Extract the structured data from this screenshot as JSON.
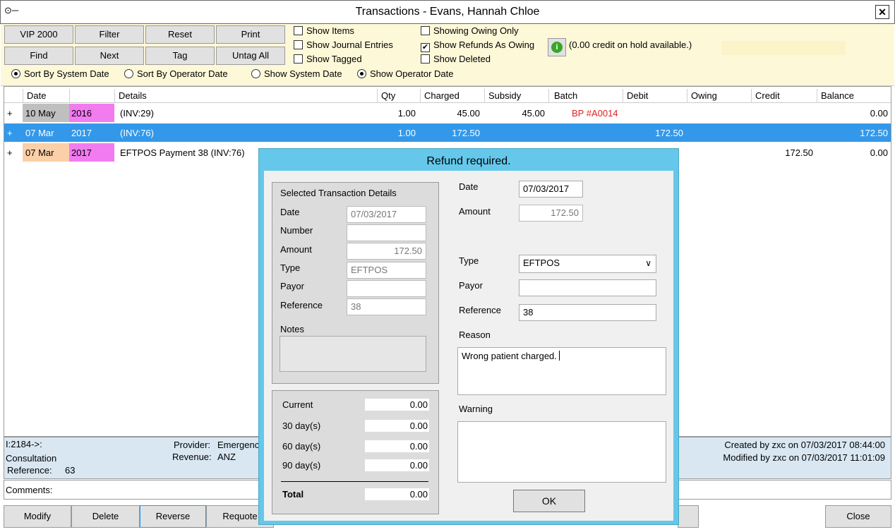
{
  "window": {
    "title": "Transactions - Evans, Hannah Chloe"
  },
  "toolbar": {
    "buttons": [
      "VIP 2000",
      "Filter",
      "Reset",
      "Print",
      "Find",
      "Next",
      "Tag",
      "Untag All"
    ],
    "checkboxes": [
      {
        "label": "Show Items",
        "checked": false
      },
      {
        "label": "Show Journal Entries",
        "checked": false
      },
      {
        "label": "Show Tagged",
        "checked": false
      },
      {
        "label": "Showing Owing Only",
        "checked": false
      },
      {
        "label": "Show Refunds As Owing",
        "checked": true
      },
      {
        "label": "Show Deleted",
        "checked": false
      }
    ],
    "radios": [
      {
        "label": "Sort By System Date",
        "selected": true
      },
      {
        "label": "Sort By Operator Date",
        "selected": false
      },
      {
        "label": "Show System Date",
        "selected": false
      },
      {
        "label": "Show Operator Date",
        "selected": true
      }
    ],
    "credit_text": "(0.00 credit on hold available.)"
  },
  "grid": {
    "headers": [
      "Date",
      "Details",
      "Qty",
      "Charged",
      "Subsidy",
      "Batch",
      "Debit",
      "Owing",
      "Credit",
      "Balance"
    ],
    "rows": [
      {
        "expand": "+",
        "date": "10 May",
        "year": "2016",
        "details": "(INV:29)",
        "qty": "1.00",
        "charged": "45.00",
        "subsidy": "45.00",
        "batch": "BP #A0014",
        "debit": "",
        "owing": "",
        "credit": "",
        "balance": "0.00"
      },
      {
        "expand": "+",
        "date": "07 Mar",
        "year": "2017",
        "details": "(INV:76)",
        "qty": "1.00",
        "charged": "172.50",
        "subsidy": "",
        "batch": "",
        "debit": "172.50",
        "owing": "",
        "credit": "",
        "balance": "172.50"
      },
      {
        "expand": "+",
        "date": "07 Mar",
        "year": "2017",
        "details": "EFTPOS Payment  38  (INV:76)",
        "qty": "",
        "charged": "",
        "subsidy": "",
        "batch": "",
        "debit": "",
        "owing": "",
        "credit": "172.50",
        "balance": "0.00"
      }
    ]
  },
  "info": {
    "line1": "I:2184->:",
    "line2": "Consultation",
    "reference_label": "Reference:",
    "reference_value": "63",
    "provider_label": "Provider:",
    "provider_value": "Emergenc",
    "revenue_label": "Revenue:",
    "revenue_value": "ANZ",
    "created": "Created by zxc on 07/03/2017 08:44:00",
    "modified": "Modified by zxc on 07/03/2017 11:01:09"
  },
  "comments_label": "Comments:",
  "bottom_buttons": {
    "modify": "Modify",
    "delete": "Delete",
    "reverse": "Reverse",
    "requote": "Requote",
    "close": "Close"
  },
  "modal": {
    "title": "Refund required.",
    "selected": {
      "heading": "Selected Transaction Details",
      "date_label": "Date",
      "date_value": "07/03/2017",
      "number_label": "Number",
      "number_value": "",
      "amount_label": "Amount",
      "amount_value": "172.50",
      "type_label": "Type",
      "type_value": "EFTPOS",
      "payor_label": "Payor",
      "payor_value": "",
      "reference_label": "Reference",
      "reference_value": "38",
      "notes_label": "Notes"
    },
    "aging": {
      "current_label": "Current",
      "current_value": "0.00",
      "d30_label": "30 day(s)",
      "d30_value": "0.00",
      "d60_label": "60 day(s)",
      "d60_value": "0.00",
      "d90_label": "90 day(s)",
      "d90_value": "0.00",
      "total_label": "Total",
      "total_value": "0.00"
    },
    "refund": {
      "date_label": "Date",
      "date_value": "07/03/2017",
      "amount_label": "Amount",
      "amount_value": "172.50",
      "type_label": "Type",
      "type_value": "EFTPOS",
      "payor_label": "Payor",
      "payor_value": "",
      "reference_label": "Reference",
      "reference_value": "38",
      "reason_label": "Reason",
      "reason_value": "Wrong patient charged.",
      "warning_label": "Warning"
    },
    "ok": "OK"
  }
}
